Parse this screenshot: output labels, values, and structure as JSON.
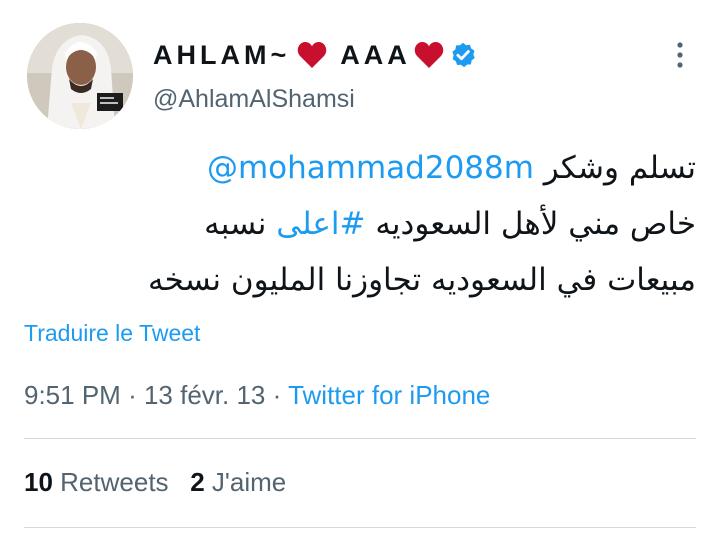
{
  "author": {
    "display_name": "AHLAM~",
    "display_name_suffix": "AAA",
    "handle": "@AhlamAlShamsi",
    "verified": true
  },
  "tweet": {
    "line1_mention": "@mohammad2088m",
    "line1_text": "تسلم وشكر",
    "line2_text_before": "خاص مني لأهل السعوديه",
    "line2_hashtag": "#اعلى",
    "line2_text_after": "نسبه",
    "line3_text": "مبيعات في السعوديه تجاوزنا المليون نسخه"
  },
  "translate_label": "Traduire le Tweet",
  "meta": {
    "time": "9:51 PM",
    "date": "13 févr. 13",
    "source": "Twitter for iPhone",
    "separator": "·"
  },
  "stats": {
    "retweets_count": "10",
    "retweets_label": "Retweets",
    "likes_count": "2",
    "likes_label": "J'aime"
  },
  "icons": {
    "heart": "heart-icon",
    "verified": "verified-badge-icon",
    "more": "more-icon"
  },
  "colors": {
    "accent": "#1d9bf0",
    "heart": "#c8102e",
    "muted": "#536471",
    "text": "#0f1419",
    "divider": "#cfd9de"
  }
}
